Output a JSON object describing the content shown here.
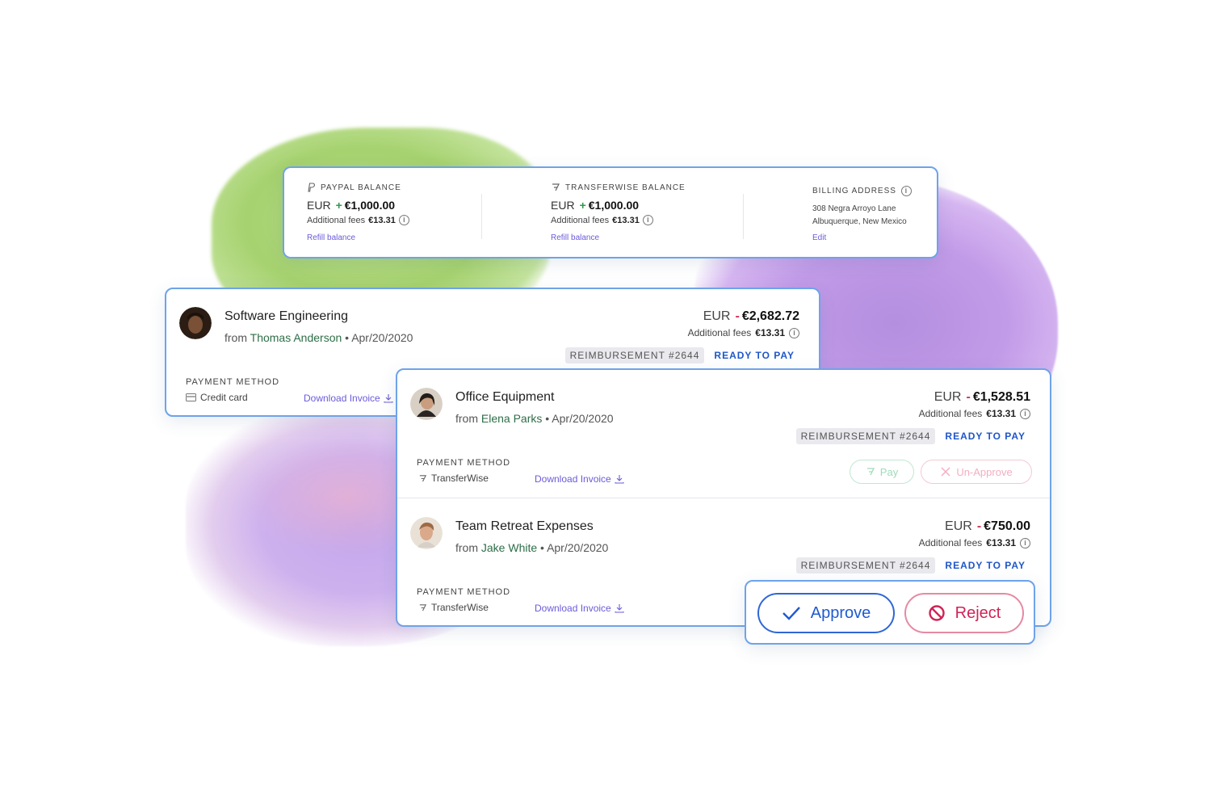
{
  "balances": {
    "paypal": {
      "title": "PAYPAL BALANCE",
      "currency": "EUR",
      "sign": "+",
      "amount": "€1,000.00",
      "fees_label": "Additional fees",
      "fees_value": "€13.31",
      "link": "Refill balance",
      "icon": "paypal-icon"
    },
    "transferwise": {
      "title": "TRANSFERWISE BALANCE",
      "currency": "EUR",
      "sign": "+",
      "amount": "€1,000.00",
      "fees_label": "Additional fees",
      "fees_value": "€13.31",
      "link": "Refill balance",
      "icon": "transferwise-icon"
    },
    "billing": {
      "title": "BILLING ADDRESS",
      "line1": "308 Negra Arroyo Lane",
      "line2": "Albuquerque, New Mexico",
      "link": "Edit"
    }
  },
  "expenses": [
    {
      "title": "Software Engineering",
      "from_label": "from",
      "from_name": "Thomas Anderson",
      "date": "Apr/20/2020",
      "currency": "EUR",
      "sign": "-",
      "amount": "€2,682.72",
      "fees_label": "Additional fees",
      "fees_value": "€13.31",
      "badge": "REIMBURSEMENT #2644",
      "status": "READY TO PAY",
      "pm_label": "PAYMENT METHOD",
      "pm_value": "Credit card",
      "download": "Download Invoice"
    },
    {
      "title": "Office Equipment",
      "from_label": "from",
      "from_name": "Elena Parks",
      "date": "Apr/20/2020",
      "currency": "EUR",
      "sign": "-",
      "amount": "€1,528.51",
      "fees_label": "Additional fees",
      "fees_value": "€13.31",
      "badge": "REIMBURSEMENT #2644",
      "status": "READY TO PAY",
      "pm_label": "PAYMENT METHOD",
      "pm_value": "TransferWise",
      "download": "Download Invoice",
      "pay_label": "Pay",
      "unapprove_label": "Un-Approve"
    },
    {
      "title": "Team Retreat Expenses",
      "from_label": "from",
      "from_name": "Jake White",
      "date": "Apr/20/2020",
      "currency": "EUR",
      "sign": "-",
      "amount": "€750.00",
      "fees_label": "Additional fees",
      "fees_value": "€13.31",
      "badge": "REIMBURSEMENT #2644",
      "status": "READY TO PAY",
      "pm_label": "PAYMENT METHOD",
      "pm_value": "TransferWise",
      "download": "Download Invoice"
    }
  ],
  "actions": {
    "approve": "Approve",
    "reject": "Reject"
  },
  "colors": {
    "accent_blue": "#1e56c9",
    "card_border": "#6ea3ea",
    "positive": "#2e9a4a",
    "negative": "#d0325a",
    "link": "#6b5bd9",
    "name_green": "#2d6e47"
  }
}
